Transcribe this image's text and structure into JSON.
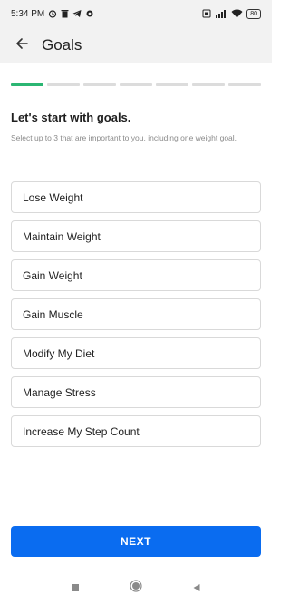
{
  "status_bar": {
    "time": "5:34 PM",
    "battery": "80",
    "icons": [
      "alarm-icon",
      "trash-icon",
      "telegram-icon",
      "settings-icon",
      "sim-icon",
      "signal-icon",
      "wifi-icon",
      "battery-icon"
    ]
  },
  "app_bar": {
    "title": "Goals",
    "back_icon": "arrow-left-icon"
  },
  "progress": {
    "total_steps": 7,
    "current_step": 1,
    "active_color": "#2bb673"
  },
  "intro": {
    "heading": "Let's start with goals.",
    "subtext": "Select up to 3 that are important to you, including one weight goal."
  },
  "goals": [
    {
      "label": "Lose Weight"
    },
    {
      "label": "Maintain Weight"
    },
    {
      "label": "Gain Weight"
    },
    {
      "label": "Gain Muscle"
    },
    {
      "label": "Modify My Diet"
    },
    {
      "label": "Manage Stress"
    },
    {
      "label": "Increase My Step Count"
    }
  ],
  "next_button": {
    "label": "NEXT",
    "color": "#0a6cf0"
  },
  "nav_bar": {
    "icons": [
      "recents-icon",
      "home-icon",
      "back-icon"
    ]
  }
}
